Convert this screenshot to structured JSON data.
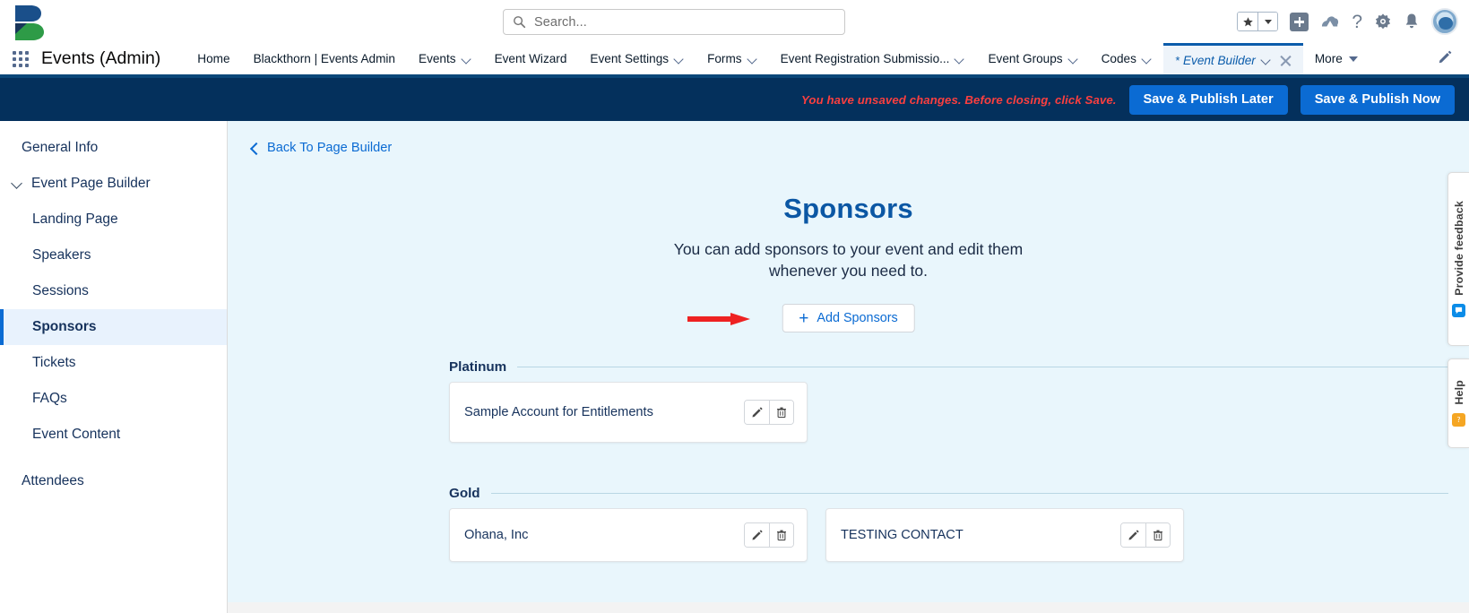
{
  "header": {
    "logo_name": "blackthorn-logo",
    "search": {
      "placeholder": "Search...",
      "value": "",
      "icon": "search-icon"
    },
    "icons": [
      {
        "name": "favorites-star-icon",
        "glyph": "★"
      },
      {
        "name": "favorites-dropdown-icon",
        "glyph": "▾"
      },
      {
        "name": "add-icon",
        "glyph": "+"
      },
      {
        "name": "cloud-setup-icon",
        "glyph": "⛰"
      },
      {
        "name": "help-question-icon",
        "glyph": "?"
      },
      {
        "name": "setup-gear-icon",
        "glyph": "⚙"
      },
      {
        "name": "notifications-bell-icon",
        "glyph": "🔔"
      },
      {
        "name": "user-avatar",
        "glyph": ""
      }
    ]
  },
  "nav": {
    "app_name": "Events (Admin)",
    "app_launcher_label": "app-launcher",
    "items": [
      {
        "label": "Home",
        "has_caret": false,
        "active": false
      },
      {
        "label": "Blackthorn | Events Admin",
        "has_caret": false,
        "active": false
      },
      {
        "label": "Events",
        "has_caret": true,
        "active": false
      },
      {
        "label": "Event Wizard",
        "has_caret": false,
        "active": false
      },
      {
        "label": "Event Settings",
        "has_caret": true,
        "active": false
      },
      {
        "label": "Forms",
        "has_caret": true,
        "active": false
      },
      {
        "label": "Event Registration Submissio...",
        "has_caret": true,
        "active": false
      },
      {
        "label": "Event Groups",
        "has_caret": true,
        "active": false
      },
      {
        "label": "Codes",
        "has_caret": true,
        "active": false
      }
    ],
    "active_tab": {
      "unsaved_marker": "*",
      "label": "Event Builder",
      "has_caret": true,
      "has_close": true
    },
    "more": {
      "label": "More"
    },
    "edit_icon": "pencil-edit-icon"
  },
  "unsaved_bar": {
    "message": "You have unsaved changes. Before closing, click Save.",
    "save_later_label": "Save & Publish Later",
    "save_now_label": "Save & Publish Now",
    "bg_color": "#04305c",
    "message_color": "#fc3f3f",
    "button_color": "#0b6bd3"
  },
  "sidebar": {
    "items": [
      {
        "label": "General Info",
        "level": 1,
        "type": "item",
        "selected": false
      },
      {
        "label": "Event Page Builder",
        "level": 1,
        "type": "group",
        "selected": false
      },
      {
        "label": "Landing Page",
        "level": 2,
        "type": "item",
        "selected": false
      },
      {
        "label": "Speakers",
        "level": 2,
        "type": "item",
        "selected": false
      },
      {
        "label": "Sessions",
        "level": 2,
        "type": "item",
        "selected": false
      },
      {
        "label": "Sponsors",
        "level": 2,
        "type": "item",
        "selected": true
      },
      {
        "label": "Tickets",
        "level": 2,
        "type": "item",
        "selected": false
      },
      {
        "label": "FAQs",
        "level": 2,
        "type": "item",
        "selected": false
      },
      {
        "label": "Event Content",
        "level": 2,
        "type": "item",
        "selected": false
      },
      {
        "label": "Attendees",
        "level": 1,
        "type": "item",
        "selected": false
      }
    ]
  },
  "main": {
    "back_link": "Back To Page Builder",
    "title": "Sponsors",
    "subtitle": "You can add sponsors to your event and edit them whenever you need to.",
    "add_button": {
      "label": "Add Sponsors",
      "icon": "plus-icon"
    },
    "annotation": {
      "name": "red-arrow-annotation",
      "color": "#ee2222"
    },
    "tiers": [
      {
        "label": "Platinum",
        "sponsors": [
          {
            "name": "Sample Account for Entitlements",
            "edit_icon": "pencil-edit-icon",
            "delete_icon": "trash-delete-icon"
          }
        ]
      },
      {
        "label": "Gold",
        "sponsors": [
          {
            "name": "Ohana, Inc",
            "edit_icon": "pencil-edit-icon",
            "delete_icon": "trash-delete-icon"
          },
          {
            "name": "TESTING CONTACT",
            "edit_icon": "pencil-edit-icon",
            "delete_icon": "trash-delete-icon"
          }
        ]
      }
    ],
    "bg_color": "#e9f6fc",
    "title_color": "#0b57a4"
  },
  "right_rail": {
    "feedback_label": "Provide feedback",
    "feedback_badge_icon": "feedback-badge-icon",
    "help_label": "Help",
    "help_badge_icon": "help-badge-icon"
  }
}
